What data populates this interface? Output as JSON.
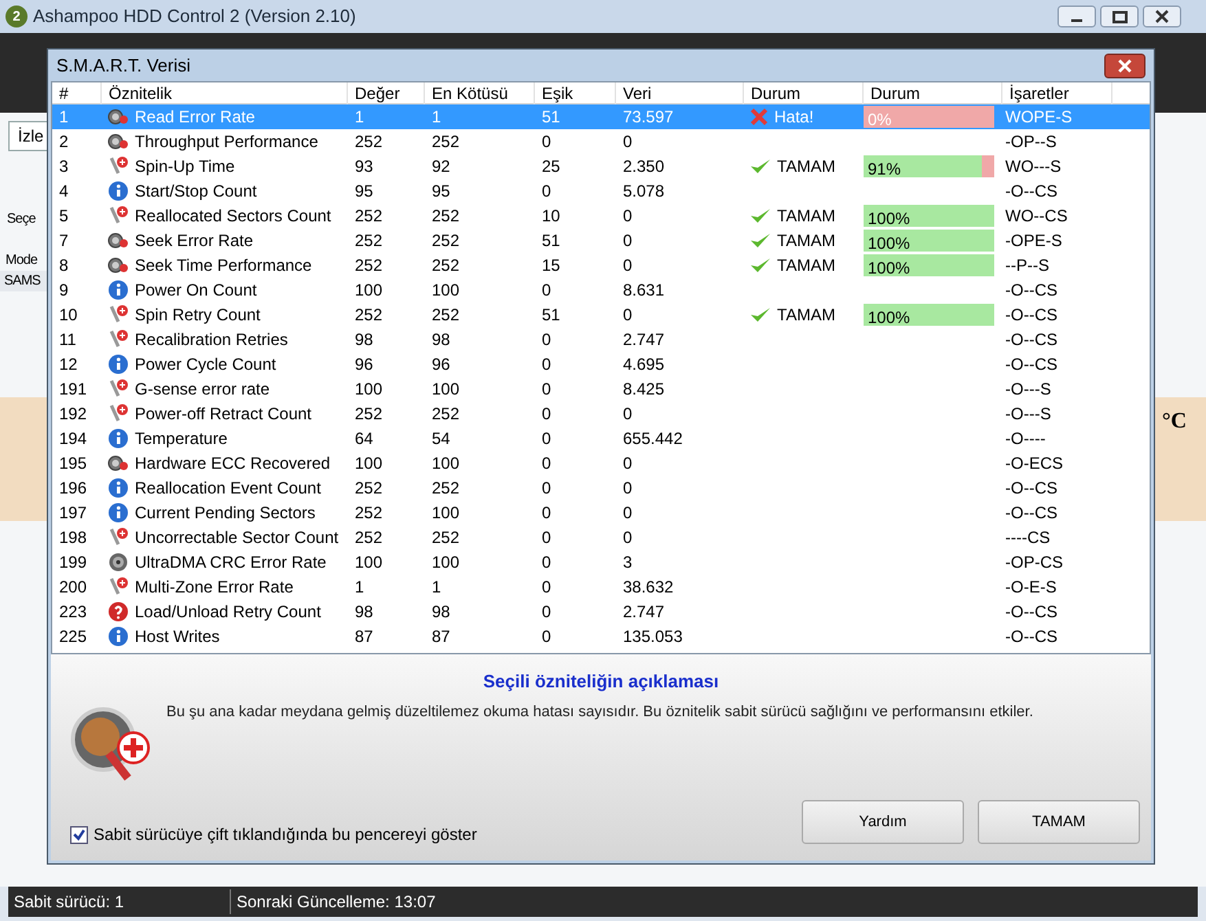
{
  "app_window": {
    "title": "Ashampoo HDD Control 2 (Version 2.10)",
    "app_badge": "2",
    "tab": "İzle",
    "left_labels": [
      "Seçe",
      "Mode",
      "SAMS"
    ],
    "temperature_unit": "°C"
  },
  "status_bar": [
    "Sabit sürücü: 1",
    "Sonraki Güncelleme: 13:07"
  ],
  "dialog": {
    "title": "S.M.A.R.T. Verisi",
    "table": {
      "columns": [
        "#",
        "Öznitelik",
        "Değer",
        "En Kötüsü",
        "Eşik",
        "Veri",
        "Durum",
        "Durum",
        "İşaretler"
      ],
      "rows": [
        {
          "id": "1",
          "kind": "gauge",
          "name": "Read Error Rate",
          "value": "1",
          "worst": "1",
          "threshold": "51",
          "data": "73.597",
          "status": {
            "kind": "error",
            "text": "Hata!"
          },
          "health": {
            "level": 0,
            "text": "0%"
          },
          "flags": "WOPE-S",
          "selected": true
        },
        {
          "id": "2",
          "kind": "gauge",
          "name": "Throughput Performance",
          "value": "252",
          "worst": "252",
          "threshold": "0",
          "data": "0",
          "flags": "-OP--S",
          "selected": false
        },
        {
          "id": "3",
          "kind": "probe",
          "name": "Spin-Up Time",
          "value": "93",
          "worst": "92",
          "threshold": "25",
          "data": "2.350",
          "status": {
            "kind": "ok",
            "text": "TAMAM"
          },
          "health": {
            "level": 0.91,
            "text": "91%"
          },
          "flags": "WO---S",
          "selected": false
        },
        {
          "id": "4",
          "kind": "info",
          "name": "Start/Stop Count",
          "value": "95",
          "worst": "95",
          "threshold": "0",
          "data": "5.078",
          "flags": "-O--CS",
          "selected": false
        },
        {
          "id": "5",
          "kind": "probe",
          "name": "Reallocated Sectors Count",
          "value": "252",
          "worst": "252",
          "threshold": "10",
          "data": "0",
          "status": {
            "kind": "ok",
            "text": "TAMAM"
          },
          "health": {
            "level": 1,
            "text": "100%"
          },
          "flags": "WO--CS",
          "selected": false
        },
        {
          "id": "7",
          "kind": "gauge",
          "name": "Seek Error Rate",
          "value": "252",
          "worst": "252",
          "threshold": "51",
          "data": "0",
          "status": {
            "kind": "ok",
            "text": "TAMAM"
          },
          "health": {
            "level": 1,
            "text": "100%"
          },
          "flags": "-OPE-S",
          "selected": false
        },
        {
          "id": "8",
          "kind": "gauge",
          "name": "Seek Time Performance",
          "value": "252",
          "worst": "252",
          "threshold": "15",
          "data": "0",
          "status": {
            "kind": "ok",
            "text": "TAMAM"
          },
          "health": {
            "level": 1,
            "text": "100%"
          },
          "flags": "--P--S",
          "selected": false
        },
        {
          "id": "9",
          "kind": "info",
          "name": "Power On Count",
          "value": "100",
          "worst": "100",
          "threshold": "0",
          "data": "8.631",
          "flags": "-O--CS",
          "selected": false
        },
        {
          "id": "10",
          "kind": "probe",
          "name": "Spin Retry Count",
          "value": "252",
          "worst": "252",
          "threshold": "51",
          "data": "0",
          "status": {
            "kind": "ok",
            "text": "TAMAM"
          },
          "health": {
            "level": 1,
            "text": "100%"
          },
          "flags": "-O--CS",
          "selected": false
        },
        {
          "id": "11",
          "kind": "probe",
          "name": "Recalibration Retries",
          "value": "98",
          "worst": "98",
          "threshold": "0",
          "data": "2.747",
          "flags": "-O--CS",
          "selected": false
        },
        {
          "id": "12",
          "kind": "info",
          "name": "Power Cycle Count",
          "value": "96",
          "worst": "96",
          "threshold": "0",
          "data": "4.695",
          "flags": "-O--CS",
          "selected": false
        },
        {
          "id": "191",
          "kind": "probe",
          "name": "G-sense error rate",
          "value": "100",
          "worst": "100",
          "threshold": "0",
          "data": "8.425",
          "flags": "-O---S",
          "selected": false
        },
        {
          "id": "192",
          "kind": "probe",
          "name": "Power-off Retract Count",
          "value": "252",
          "worst": "252",
          "threshold": "0",
          "data": "0",
          "flags": "-O---S",
          "selected": false
        },
        {
          "id": "194",
          "kind": "info",
          "name": "Temperature",
          "value": "64",
          "worst": "54",
          "threshold": "0",
          "data": "655.442",
          "flags": "-O----",
          "selected": false
        },
        {
          "id": "195",
          "kind": "gauge",
          "name": "Hardware ECC Recovered",
          "value": "100",
          "worst": "100",
          "threshold": "0",
          "data": "0",
          "flags": "-O-ECS",
          "selected": false
        },
        {
          "id": "196",
          "kind": "info",
          "name": "Reallocation Event Count",
          "value": "252",
          "worst": "252",
          "threshold": "0",
          "data": "0",
          "flags": "-O--CS",
          "selected": false
        },
        {
          "id": "197",
          "kind": "info",
          "name": "Current Pending Sectors",
          "value": "252",
          "worst": "100",
          "threshold": "0",
          "data": "0",
          "flags": "-O--CS",
          "selected": false
        },
        {
          "id": "198",
          "kind": "probe",
          "name": "Uncorrectable Sector Count",
          "value": "252",
          "worst": "252",
          "threshold": "0",
          "data": "0",
          "flags": "----CS",
          "selected": false
        },
        {
          "id": "199",
          "kind": "disc",
          "name": "UltraDMA CRC Error Rate",
          "value": "100",
          "worst": "100",
          "threshold": "0",
          "data": "3",
          "flags": "-OP-CS",
          "selected": false
        },
        {
          "id": "200",
          "kind": "probe",
          "name": "Multi-Zone Error Rate",
          "value": "1",
          "worst": "1",
          "threshold": "0",
          "data": "38.632",
          "flags": "-O-E-S",
          "selected": false
        },
        {
          "id": "223",
          "kind": "help",
          "name": "Load/Unload Retry Count",
          "value": "98",
          "worst": "98",
          "threshold": "0",
          "data": "2.747",
          "flags": "-O--CS",
          "selected": false
        },
        {
          "id": "225",
          "kind": "info",
          "name": "Host Writes",
          "value": "87",
          "worst": "87",
          "threshold": "0",
          "data": "135.053",
          "flags": "-O--CS",
          "selected": false
        }
      ]
    },
    "description_title": "Seçili özniteliğin açıklaması",
    "description": "Bu şu ana kadar meydana gelmiş düzeltilemez okuma hatası sayısıdır. Bu öznitelik sabit sürücü sağlığını ve performansını etkiler.",
    "checkbox": {
      "label": "Sabit sürücüye çift tıklandığında bu pencereyi göster",
      "checked": true
    },
    "buttons": [
      "Yardım",
      "TAMAM"
    ]
  }
}
